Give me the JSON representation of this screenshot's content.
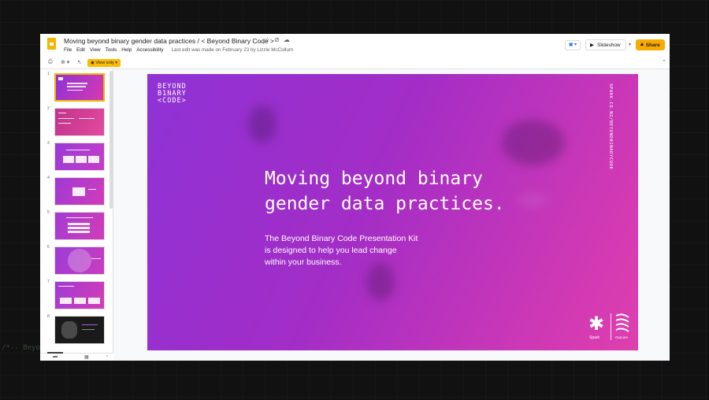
{
  "background": {
    "text": "/*-- Beyon"
  },
  "header": {
    "doc_title": "Moving beyond binary gender data practices / < Beyond Binary Code >",
    "icons": [
      "star-icon",
      "move-icon",
      "cloud-icon"
    ],
    "menu": [
      "File",
      "Edit",
      "View",
      "Tools",
      "Help",
      "Accessibility"
    ],
    "last_edit": "Last edit was made on February 23 by Lizzie McCollum",
    "present_glyph": "▣ ▾",
    "slideshow_label": "Slideshow",
    "share_label": "Share"
  },
  "toolbar": {
    "print_glyph": "⎙",
    "zoom_glyph": "⊕ ▾",
    "select_glyph": "↖",
    "view_only_label": "View only",
    "collapse_glyph": "⌃"
  },
  "filmstrip": {
    "slides": [
      {
        "num": "1",
        "style": "title",
        "active": true
      },
      {
        "num": "2",
        "style": "pink"
      },
      {
        "num": "3",
        "style": "purple-cards"
      },
      {
        "num": "4",
        "style": "purple-box"
      },
      {
        "num": "5",
        "style": "purple-list"
      },
      {
        "num": "6",
        "style": "purple-circle"
      },
      {
        "num": "7",
        "style": "purple-cards2"
      },
      {
        "num": "8",
        "style": "dark"
      }
    ],
    "bottom_icons": [
      "list-view-icon",
      "grid-view-icon",
      "collapse-panel-icon"
    ]
  },
  "slide": {
    "logo_lines": [
      "BEYOND",
      "B1NARY",
      "<CODE>"
    ],
    "vertical_url": "SPARK.CO.NZ/BEYONDBINARYCODE",
    "title": "Moving beyond binary\ngender data practices.",
    "body": "The Beyond Binary Code Presentation Kit\nis designed to help you lead change\nwithin your business.",
    "brand_spark": "Spark",
    "brand_ourline": "OurLine"
  },
  "colors": {
    "accent": "#f9ab00",
    "slide_gradient_start": "#8f32d6",
    "slide_gradient_end": "#de3fae"
  }
}
